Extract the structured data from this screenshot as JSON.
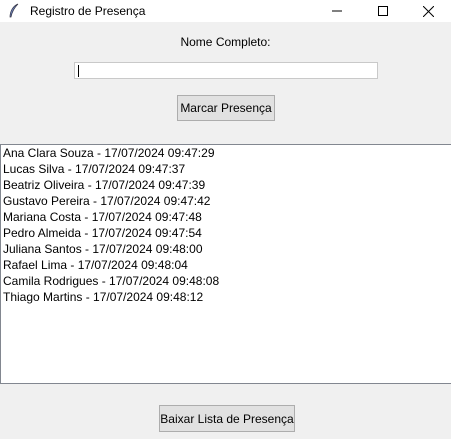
{
  "window": {
    "title": "Registro de Presença",
    "icon": "feather-icon",
    "controls": [
      "minimize-icon",
      "maximize-icon",
      "close-icon"
    ]
  },
  "form": {
    "name_label": "Nome Completo:",
    "name_value": "",
    "mark_button": "Marcar Presença"
  },
  "attendance": [
    "Ana Clara Souza - 17/07/2024 09:47:29",
    "Lucas Silva - 17/07/2024 09:47:37",
    "Beatriz Oliveira - 17/07/2024 09:47:39",
    "Gustavo Pereira - 17/07/2024 09:47:42",
    "Mariana Costa - 17/07/2024 09:47:48",
    "Pedro Almeida - 17/07/2024 09:47:54",
    "Juliana Santos - 17/07/2024 09:48:00",
    "Rafael Lima - 17/07/2024 09:48:04",
    "Camila Rodrigues - 17/07/2024 09:48:08",
    "Thiago Martins - 17/07/2024 09:48:12"
  ],
  "footer": {
    "download_button": "Baixar Lista de Presença"
  }
}
